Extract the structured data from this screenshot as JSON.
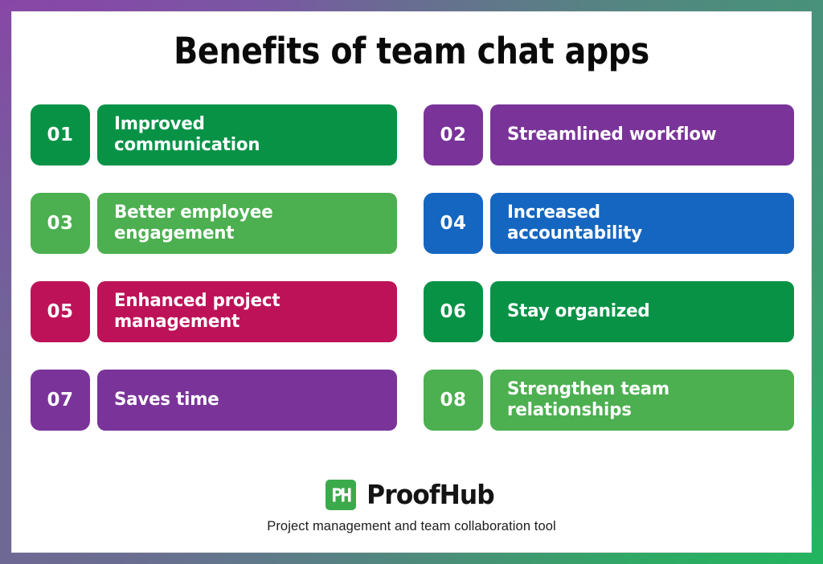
{
  "page": {
    "title": "Benefits of team chat apps",
    "background_color": "#ffffff",
    "border_gradient": {
      "top_left": "#8b43a8",
      "top_right": "#479279",
      "bottom_right": "#22b55f",
      "bottom_left": "#6e6894"
    }
  },
  "benefits": [
    {
      "number": "01",
      "label": "Improved\ncommunication",
      "color": "#079246",
      "badge_color": "#079246"
    },
    {
      "number": "02",
      "label": "Streamlined workflow",
      "color": "#7a3499",
      "badge_color": "#7a3499"
    },
    {
      "number": "03",
      "label": "Better employee\nengagement",
      "color": "#4caf50",
      "badge_color": "#4caf50"
    },
    {
      "number": "04",
      "label": "Increased\naccountability",
      "color": "#1566c0",
      "badge_color": "#1566c0"
    },
    {
      "number": "05",
      "label": "Enhanced project\nmanagement",
      "color": "#be1258",
      "badge_color": "#be1258"
    },
    {
      "number": "06",
      "label": "Stay organized",
      "color": "#079246",
      "badge_color": "#079246"
    },
    {
      "number": "07",
      "label": "Saves time",
      "color": "#7a3499",
      "badge_color": "#7a3499"
    },
    {
      "number": "08",
      "label": "Strengthen team\nrelationships",
      "color": "#4caf50",
      "badge_color": "#4caf50"
    }
  ],
  "footer": {
    "logo_mark_text": "PH",
    "logo_mark_color": "#3baa4b",
    "brand_name": "ProofHub",
    "tagline": "Project management and team collaboration tool"
  }
}
